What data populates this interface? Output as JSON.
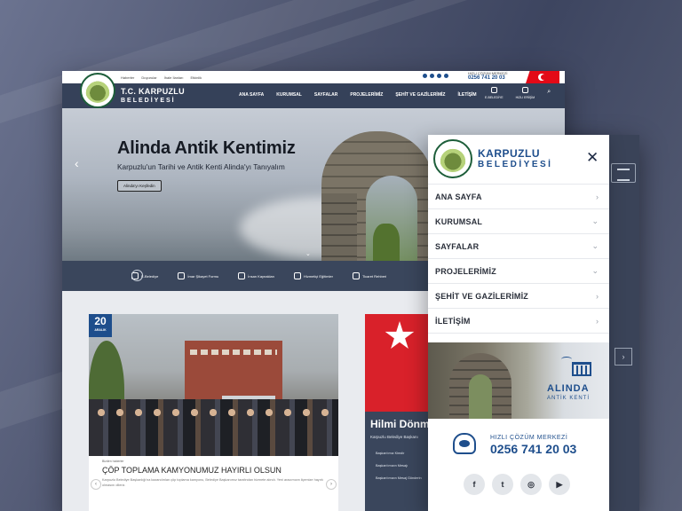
{
  "desktop": {
    "topbar": {
      "links": [
        "Haberler",
        "Duyurular",
        "İhale İlanları",
        "Etkinlik"
      ],
      "phone_caption": "HIZLI ÇÖZÜM MERKEZİ",
      "phone": "0256 741 20 03"
    },
    "brand": {
      "line1": "T.C. KARPUZLU",
      "line2": "BELEDİYESİ"
    },
    "menu": [
      "ANA SAYFA",
      "KURUMSAL",
      "SAYFALAR",
      "PROJELERİMİZ",
      "ŞEHİT VE GAZİLERİMİZ",
      "İLETİŞİM"
    ],
    "right_icons": [
      "E-BELEDİYE",
      "HIZLI ERİŞİM"
    ],
    "hero": {
      "title": "Alinda Antik Kentimiz",
      "subtitle": "Karpuzlu'un Tarihi ve Antik Kenti Alinda'yı Tanıyalım",
      "button": "Alinda'yı Keşfedin"
    },
    "quick_links": [
      "E-Belediye",
      "İmar Şikayet Formu",
      "İnsan Kaynakları",
      "Hizmetiçi Eğitimler",
      "Ticaret Rehberi"
    ],
    "news": {
      "day": "20",
      "month": "ARALIK",
      "category": "Bizden haberler",
      "title": "ÇÖP TOPLAMA KAMYONUMUZ HAYIRLI OLSUN",
      "excerpt": "Karpuzlu Belediye Başkanlığı'na kazandırılan çöp toplama kamyonu, Belediye Başkanımız tarafından hizmete alındı. Yeni aracımızın ilçemize hayırlı olmasını dileriz."
    },
    "mayor": {
      "name": "Hilmi Dönmez",
      "role": "Karpuzlu Belediye Başkanı",
      "links": [
        "Başkan'ımız Kimdir",
        "Başkan'ımızın Mesajı",
        "Başkan'ımızın Mesaj Gönderin"
      ]
    }
  },
  "mobile": {
    "brand": {
      "line1": "KARPUZLU",
      "line2": "BELEDİYESİ"
    },
    "menu": [
      {
        "label": "ANA SAYFA",
        "caret": "›"
      },
      {
        "label": "KURUMSAL",
        "caret": "⌄"
      },
      {
        "label": "SAYFALAR",
        "caret": "⌄"
      },
      {
        "label": "PROJELERİMİZ",
        "caret": "⌄"
      },
      {
        "label": "ŞEHİT VE GAZİLERİMİZ",
        "caret": "›"
      },
      {
        "label": "İLETİŞİM",
        "caret": "›"
      }
    ],
    "banner": {
      "title": "ALINDA",
      "subtitle": "ANTİK KENTİ"
    },
    "call": {
      "caption": "HIZLI ÇÖZÜM MERKEZİ",
      "number": "0256 741 20 03"
    },
    "social": [
      {
        "icon": "facebook-icon",
        "glyph": "f"
      },
      {
        "icon": "twitter-icon",
        "glyph": "t"
      },
      {
        "icon": "instagram-icon",
        "glyph": "◎"
      },
      {
        "icon": "youtube-icon",
        "glyph": "▶"
      }
    ]
  },
  "colors": {
    "brand_blue": "#1e4e8c",
    "nav_dark": "#3a465c",
    "flag_red": "#e30a17"
  }
}
